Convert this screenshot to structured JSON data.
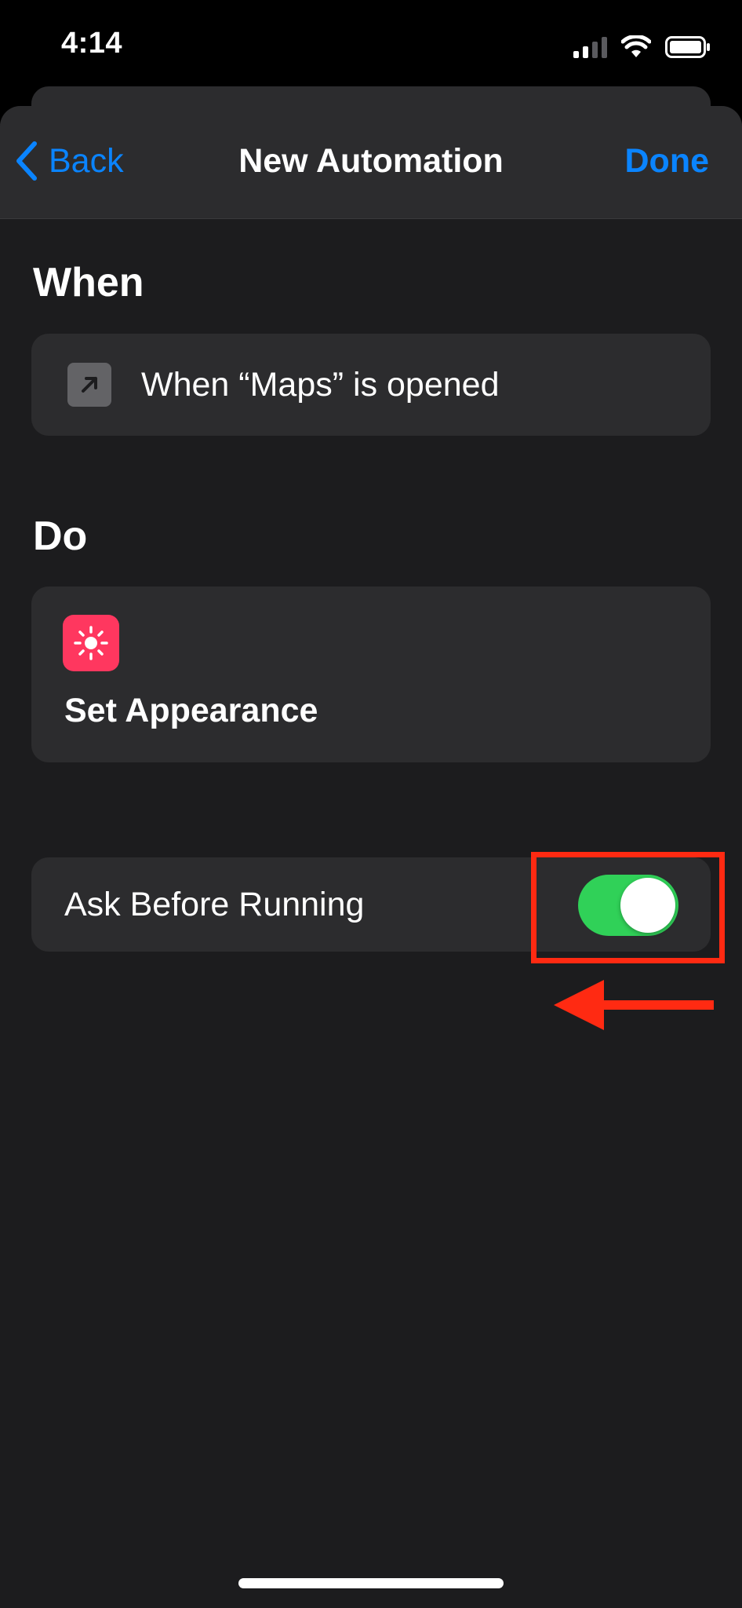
{
  "status_bar": {
    "time": "4:14",
    "signal_icon": "cellular-signal-icon",
    "wifi_icon": "wifi-icon",
    "battery_icon": "battery-icon"
  },
  "nav": {
    "back_label": "Back",
    "back_icon": "chevron-left-icon",
    "title": "New Automation",
    "done_label": "Done"
  },
  "when_section": {
    "heading": "When",
    "trigger_text": "When “Maps” is opened",
    "trigger_icon": "open-app-arrow-icon"
  },
  "do_section": {
    "heading": "Do",
    "action_label": "Set Appearance",
    "action_icon": "sun-icon",
    "action_icon_color": "#ff375f"
  },
  "ask_before_running": {
    "label": "Ask Before Running",
    "enabled": true,
    "toggle_color": "#30d158"
  },
  "annotation": {
    "highlight_color": "#ff2a12",
    "arrow_icon": "left-arrow-icon"
  },
  "colors": {
    "accent": "#0a84ff",
    "background": "#1c1c1e",
    "card": "#2c2c2e"
  }
}
